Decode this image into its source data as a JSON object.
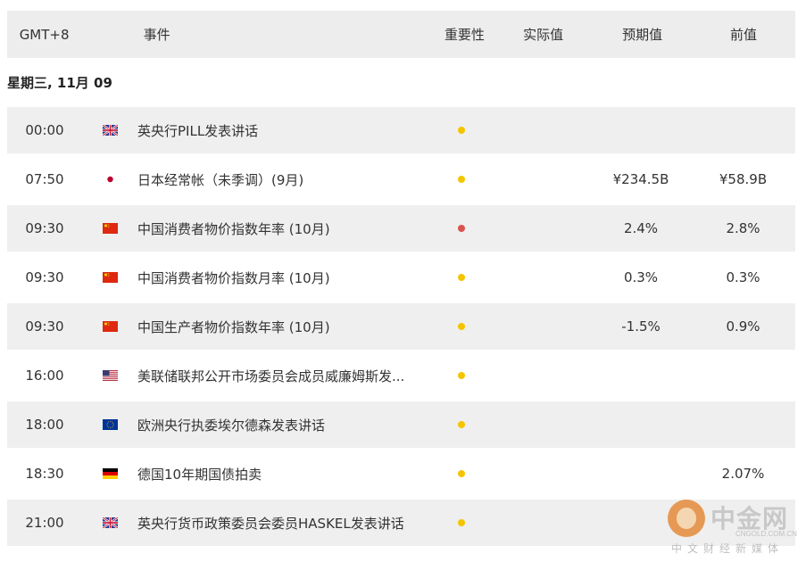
{
  "header": {
    "timezone": "GMT+8",
    "event": "事件",
    "importance": "重要性",
    "actual": "实际值",
    "forecast": "预期值",
    "previous": "前值"
  },
  "date_label": "星期三, 11月 09",
  "rows": [
    {
      "time": "00:00",
      "flag": "uk-flag",
      "event": "英央行PILL发表讲话",
      "importance": "#f5c400",
      "actual": "",
      "forecast": "",
      "previous": ""
    },
    {
      "time": "07:50",
      "flag": "japan-flag",
      "event": "日本经常帐（未季调）(9月)",
      "importance": "#f5c400",
      "actual": "",
      "forecast": "¥234.5B",
      "previous": "¥58.9B"
    },
    {
      "time": "09:30",
      "flag": "china-flag",
      "event": "中国消费者物价指数年率 (10月)",
      "importance": "#d9534f",
      "actual": "",
      "forecast": "2.4%",
      "previous": "2.8%"
    },
    {
      "time": "09:30",
      "flag": "china-flag",
      "event": "中国消费者物价指数月率 (10月)",
      "importance": "#f5c400",
      "actual": "",
      "forecast": "0.3%",
      "previous": "0.3%"
    },
    {
      "time": "09:30",
      "flag": "china-flag",
      "event": "中国生产者物价指数年率 (10月)",
      "importance": "#f5c400",
      "actual": "",
      "forecast": "-1.5%",
      "previous": "0.9%"
    },
    {
      "time": "16:00",
      "flag": "us-flag",
      "event": "美联储联邦公开市场委员会成员威廉姆斯发...",
      "importance": "#f5c400",
      "actual": "",
      "forecast": "",
      "previous": ""
    },
    {
      "time": "18:00",
      "flag": "eu-flag",
      "event": "欧洲央行执委埃尔德森发表讲话",
      "importance": "#f5c400",
      "actual": "",
      "forecast": "",
      "previous": ""
    },
    {
      "time": "18:30",
      "flag": "germany-flag",
      "event": "德国10年期国债拍卖",
      "importance": "#f5c400",
      "actual": "",
      "forecast": "",
      "previous": "2.07%"
    },
    {
      "time": "21:00",
      "flag": "uk-flag",
      "event": "英央行货币政策委员会委员HASKEL发表讲话",
      "importance": "#f5c400",
      "actual": "",
      "forecast": "",
      "previous": ""
    }
  ],
  "watermark": {
    "name": "中金网",
    "domain": "CNGOLD.COM.CN",
    "tagline": "中文财经新媒体"
  }
}
